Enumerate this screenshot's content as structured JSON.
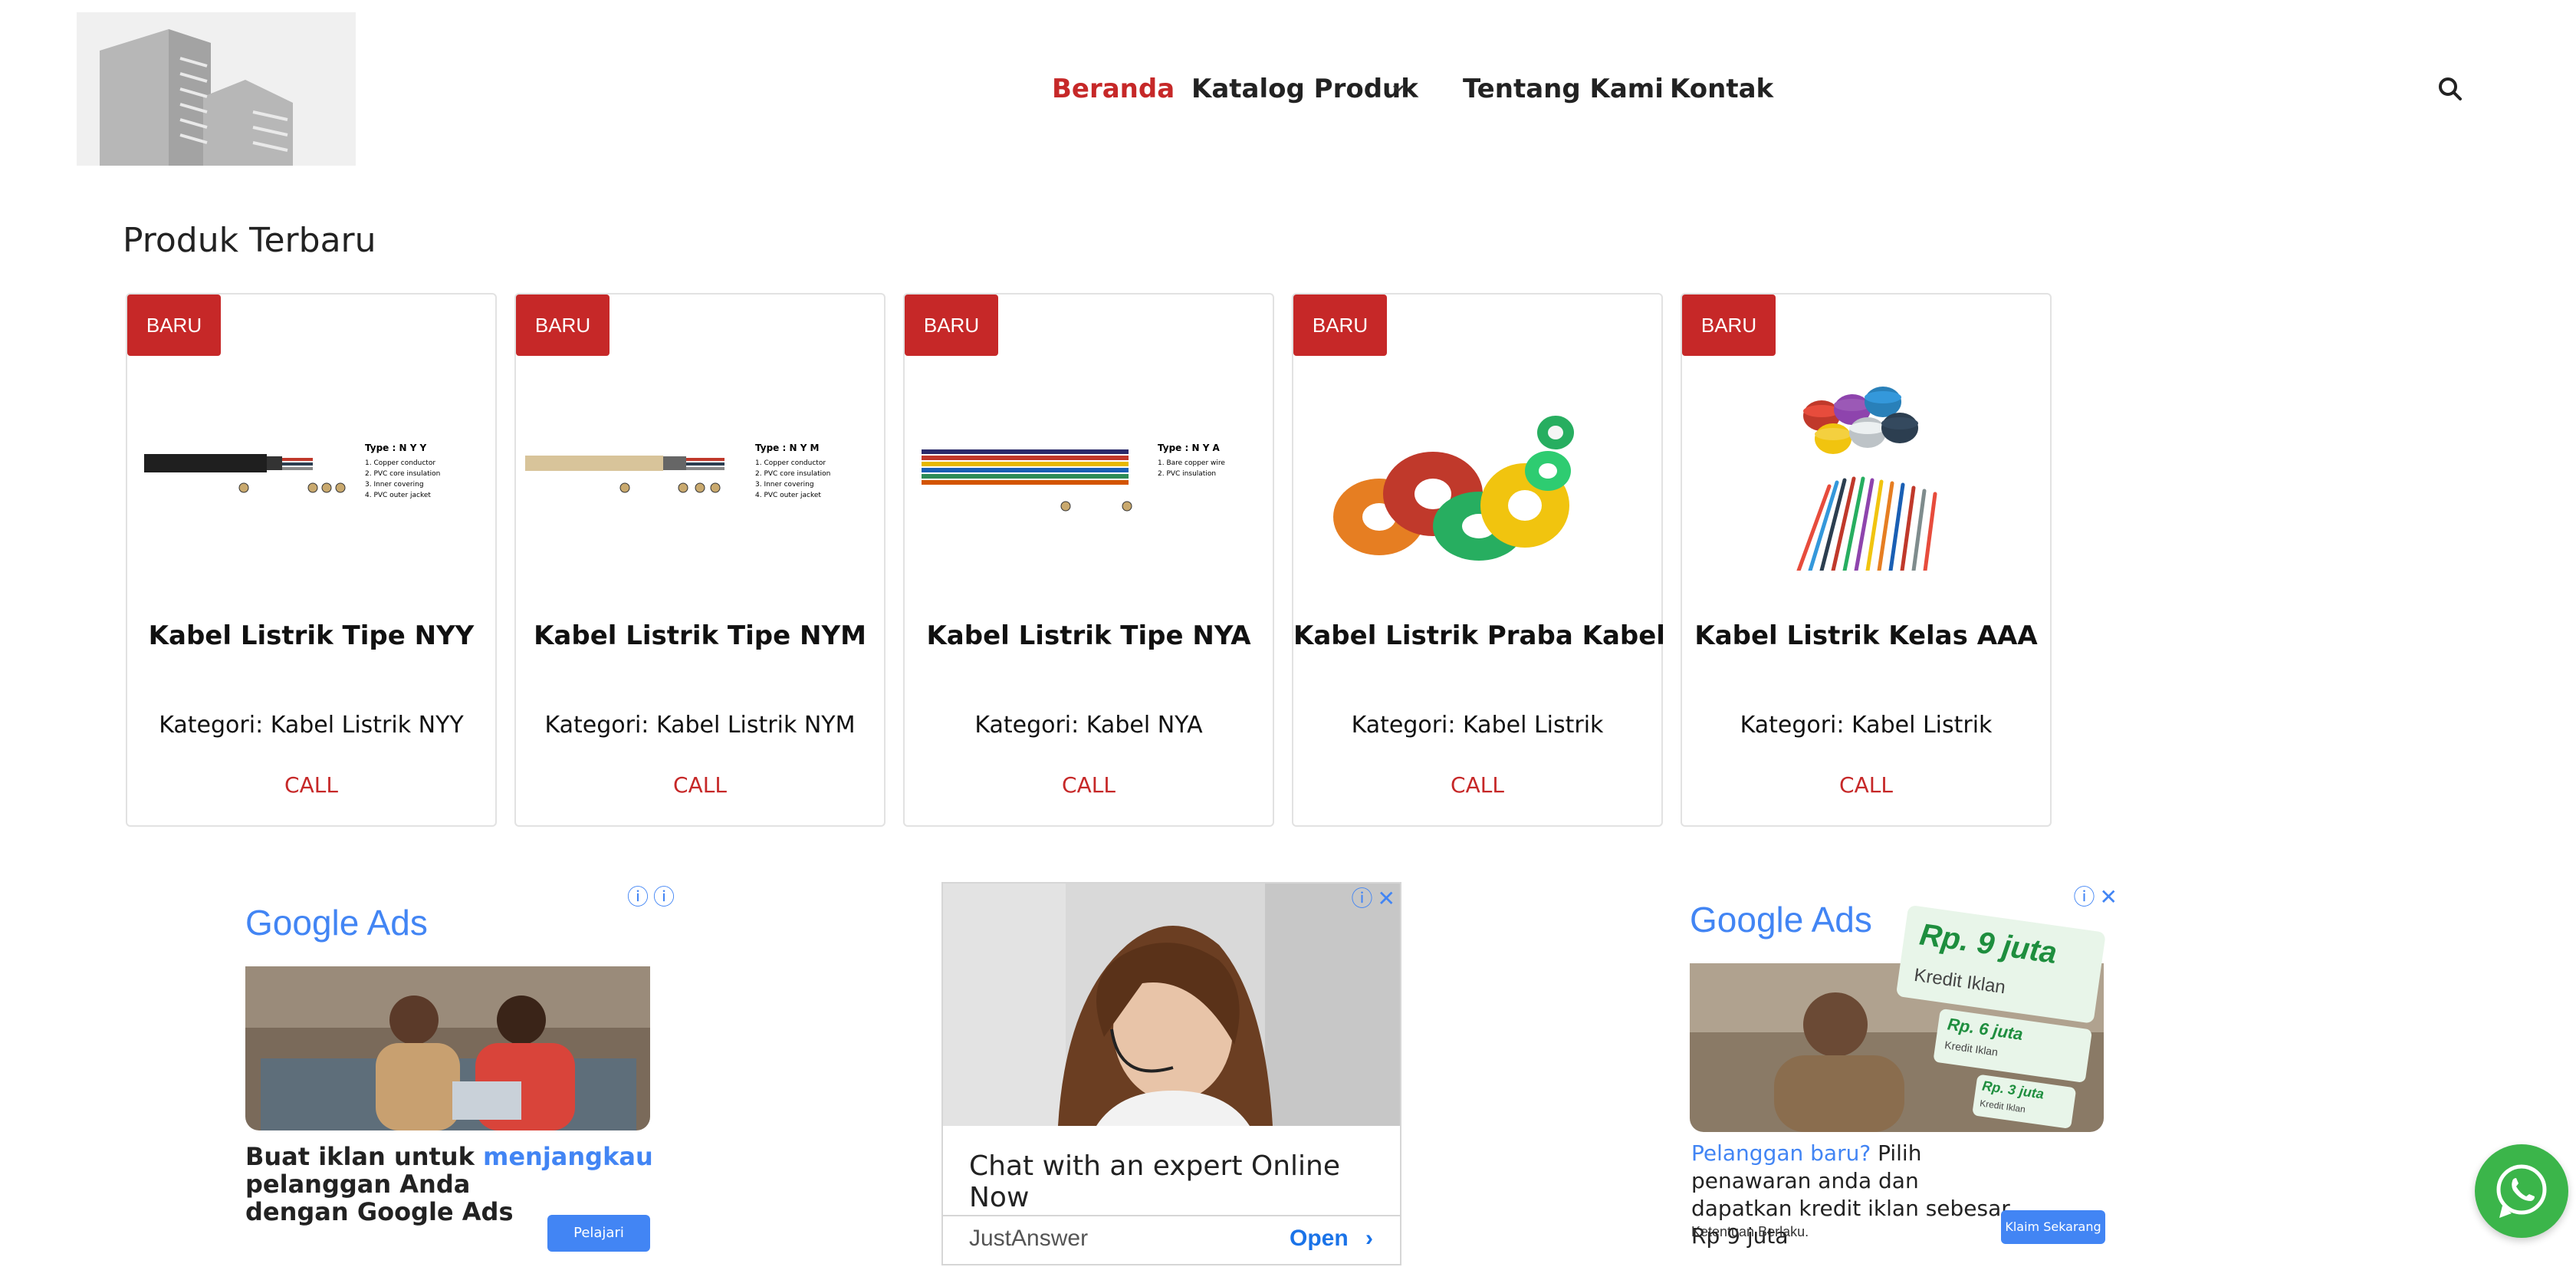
{
  "nav": {
    "items": [
      {
        "label": "Beranda",
        "active": true
      },
      {
        "label": "Katalog Produk",
        "has_dropdown": true
      },
      {
        "label": "Tentang Kami"
      },
      {
        "label": "Kontak"
      }
    ],
    "search_icon": "search-icon"
  },
  "section": {
    "title": "Produk Terbaru"
  },
  "products": [
    {
      "badge": "BARU",
      "title": "Kabel Listrik Tipe NYY",
      "category": "Kategori: Kabel Listrik NYY",
      "action": "CALL",
      "diagram_type": "Type : N Y Y",
      "diagram_lines": [
        "1. Copper conductor",
        "2. PVC core insulation",
        "3. Inner covering",
        "4. PVC outer jacket"
      ]
    },
    {
      "badge": "BARU",
      "title": "Kabel Listrik Tipe NYM",
      "category": "Kategori: Kabel Listrik NYM",
      "action": "CALL",
      "diagram_type": "Type : N Y M",
      "diagram_lines": [
        "1. Copper conductor",
        "2. PVC core insulation",
        "3. Inner covering",
        "4. PVC outer jacket"
      ]
    },
    {
      "badge": "BARU",
      "title": "Kabel Listrik Tipe NYA",
      "category": "Kategori: Kabel NYA",
      "action": "CALL",
      "diagram_type": "Type : N Y A",
      "diagram_lines": [
        "1. Bare copper wire",
        "2. PVC insulation"
      ]
    },
    {
      "badge": "BARU",
      "title": "Kabel Listrik Praba Kabel",
      "category": "Kategori: Kabel Listrik",
      "action": "CALL"
    },
    {
      "badge": "BARU",
      "title": "Kabel Listrik Kelas AAA",
      "category": "Kategori: Kabel Listrik",
      "action": "CALL"
    }
  ],
  "ads": {
    "left": {
      "brand": "Google Ads",
      "headline_pre": "Buat iklan untuk ",
      "headline_highlight": "menjangkau",
      "headline_post": "pelanggan Anda dengan Google Ads",
      "button": "Pelajari"
    },
    "center": {
      "headline": "Chat with an expert Online Now",
      "advertiser": "JustAnswer",
      "cta": "Open"
    },
    "right": {
      "brand": "Google Ads",
      "text_highlight": "Pelanggan baru?",
      "text_rest": " Pilih penawaran anda dan dapatkan kredit iklan sebesar Rp 9 juta",
      "fine_print": "Ketentuan Berlaku.",
      "button": "Klaim Sekarang",
      "tags": [
        {
          "amount": "Rp. 9 juta",
          "label": "Kredit Iklan"
        },
        {
          "amount": "Rp. 6 juta",
          "label": "Kredit Iklan"
        },
        {
          "amount": "Rp. 3 juta",
          "label": "Kredit Iklan"
        }
      ]
    }
  },
  "colors": {
    "accent": "#c62828",
    "google_blue": "#4285F4",
    "whatsapp": "#3bb54a"
  }
}
